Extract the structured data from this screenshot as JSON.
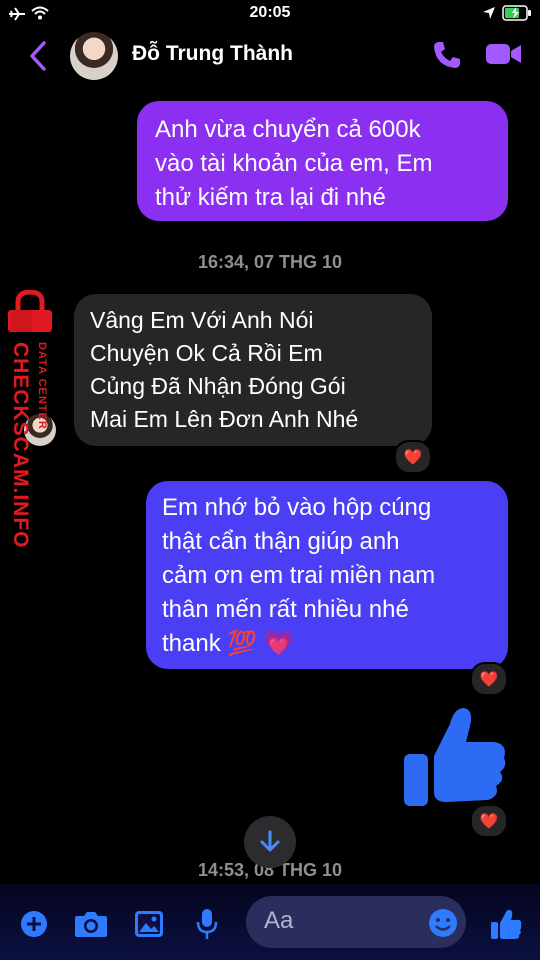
{
  "status_bar": {
    "time": "20:05"
  },
  "header": {
    "contact_name": "Đỗ Trung Thành"
  },
  "messages": [
    {
      "lines": [
        "Anh vừa chuyển cả 600k",
        "vào tài khoản của em, Em",
        "thử kiếm tra lại đi nhé"
      ]
    },
    {
      "timestamp": "16:34, 07 THG 10"
    },
    {
      "lines": [
        "Vâng Em Với Anh Nói",
        "Chuyện Ok Cả Rồi Em",
        "Củng Đã Nhận Đóng Gói",
        "Mai Em Lên Đơn Anh Nhé"
      ],
      "reaction": "❤️"
    },
    {
      "lines": [
        "Em nhớ bỏ vào hộp cúng",
        "thật cẩn thận giúp anh",
        "cảm ơn em trai miền nam",
        "thân mến rất nhiều nhé",
        "thank 💯 💗"
      ],
      "reaction": "❤️"
    },
    {
      "sticker": "thumbs-up",
      "reaction": "❤️"
    },
    {
      "timestamp": "14:53, 08 THG 10"
    }
  ],
  "composer": {
    "placeholder": "Aa"
  },
  "watermark": {
    "brand": "CHECKSCAM.INFO",
    "sub": "DATA CENTER"
  },
  "colors": {
    "accent": "#a259ff",
    "bubble_purple": "#8b2ff0",
    "bubble_blue": "#4b3ff5",
    "bubble_gray": "#262626",
    "thumb": "#2d6bf5"
  }
}
